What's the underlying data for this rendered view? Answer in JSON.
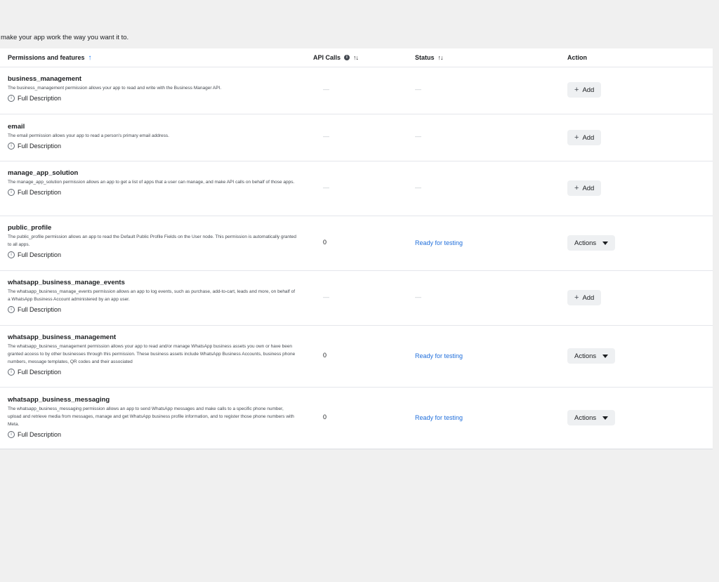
{
  "intro_text": "make your app work the way you want it to.",
  "headers": {
    "permissions": "Permissions and features",
    "api_calls": "API Calls",
    "status": "Status",
    "action": "Action"
  },
  "full_description_label": "Full Description",
  "add_label": "Add",
  "actions_label": "Actions",
  "rows": [
    {
      "name": "business_management",
      "desc": "The business_management permission allows your app to read and write with the Business Manager API.",
      "api_calls": "—",
      "status": "—",
      "action": "add"
    },
    {
      "name": "email",
      "desc": "The email permission allows your app to read a person's primary email address.",
      "api_calls": "—",
      "status": "—",
      "action": "add"
    },
    {
      "name": "manage_app_solution",
      "desc": "The manage_app_solution permission allows an app to get a list of apps that a user can manage, and make API calls on behalf of those apps.",
      "api_calls": "—",
      "status": "—",
      "action": "add"
    },
    {
      "name": "public_profile",
      "desc": "The public_profile permission allows an app to read the Default Public Profile Fields on the User node. This permission is automatically granted to all apps.",
      "api_calls": "0",
      "status": "Ready for testing",
      "action": "actions"
    },
    {
      "name": "whatsapp_business_manage_events",
      "desc": "The whatsapp_business_manage_events permission allows an app to log events, such as purchase, add-to-cart, leads and more, on behalf of a WhatsApp Business Account administered by an app user.",
      "api_calls": "—",
      "status": "—",
      "action": "add"
    },
    {
      "name": "whatsapp_business_management",
      "desc": "The whatsapp_business_management permission allows your app to read and/or manage WhatsApp business assets you own or have been granted access to by other businesses through this permission. These business assets include WhatsApp Business Accounts, business phone numbers, message templates, QR codes and their associated",
      "api_calls": "0",
      "status": "Ready for testing",
      "action": "actions"
    },
    {
      "name": "whatsapp_business_messaging",
      "desc": "The whatsapp_business_messaging permission allows an app to send WhatsApp messages and make calls to a specific phone number, upload and retrieve media from messages, manage and get WhatsApp business profile information, and to register those phone numbers with Meta.",
      "api_calls": "0",
      "status": "Ready for testing",
      "action": "actions"
    }
  ]
}
